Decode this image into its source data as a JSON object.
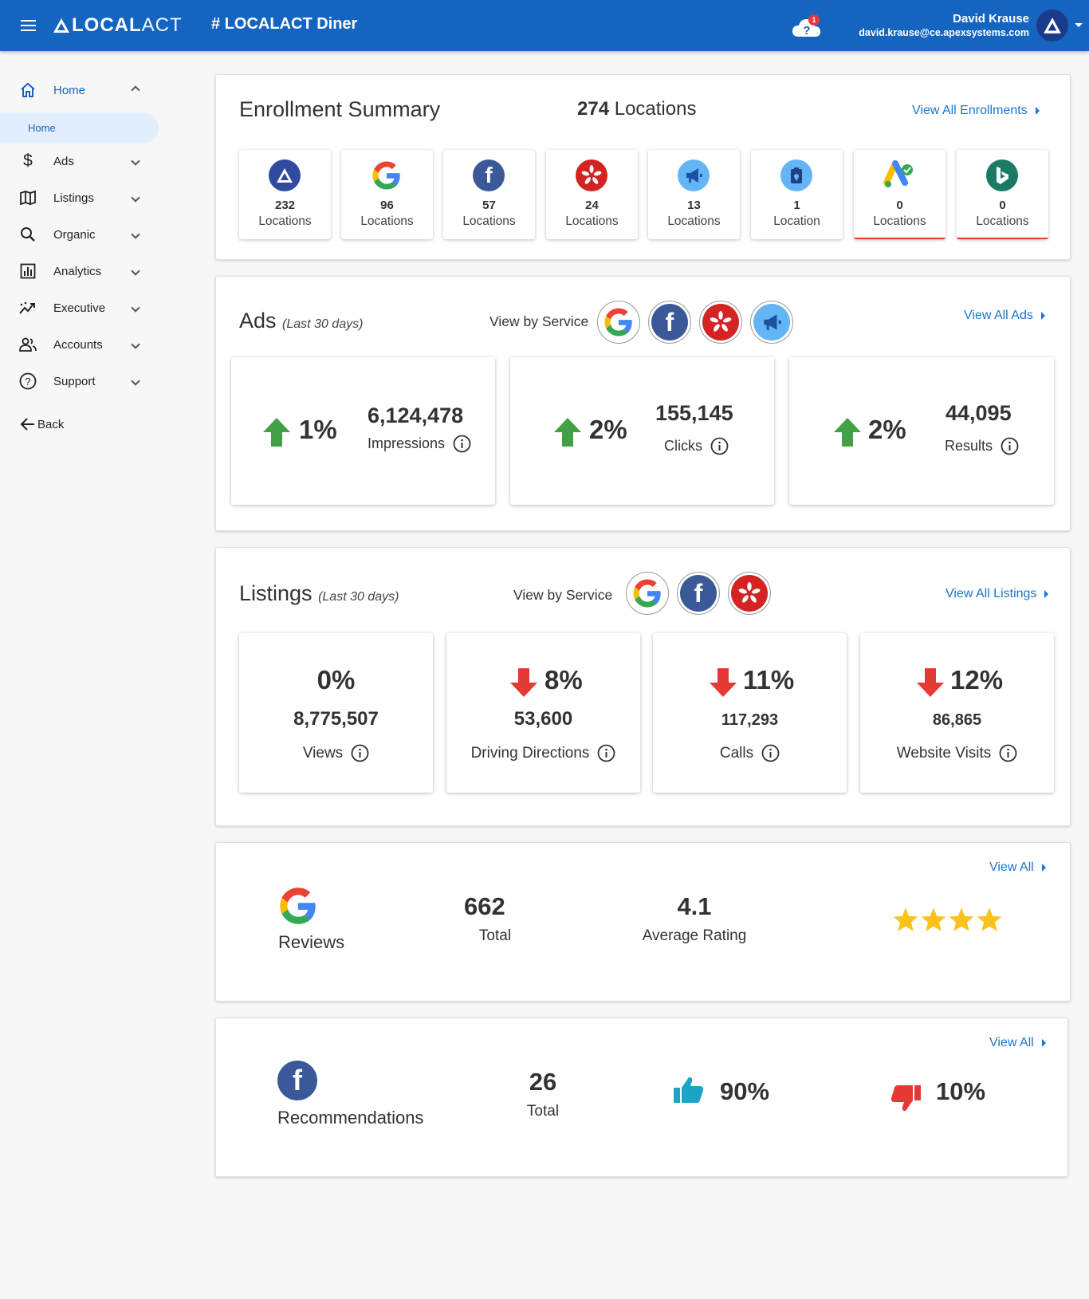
{
  "header": {
    "logo_local": "LOCAL",
    "logo_act": "ACT",
    "site_title": "# LOCALACT Diner",
    "help_badge": "1",
    "user_name": "David Krause",
    "user_email": "david.krause@ce.apexsystems.com",
    "brand_color": "#1565c0"
  },
  "sidebar": {
    "items": [
      {
        "label": "Home",
        "icon": "home-icon"
      },
      {
        "label": "Ads",
        "icon": "dollar-icon"
      },
      {
        "label": "Listings",
        "icon": "map-icon"
      },
      {
        "label": "Organic",
        "icon": "search-icon"
      },
      {
        "label": "Analytics",
        "icon": "analytics-icon"
      },
      {
        "label": "Executive",
        "icon": "trend-icon"
      },
      {
        "label": "Accounts",
        "icon": "people-icon"
      },
      {
        "label": "Support",
        "icon": "help-circle-icon"
      }
    ],
    "home_sub": "Home",
    "back": "Back"
  },
  "enrollment": {
    "title": "Enrollment Summary",
    "total_count": "274",
    "total_label": "Locations",
    "view_all": "View All Enrollments",
    "tiles": [
      {
        "service": "localact",
        "count": "232",
        "label": "Locations"
      },
      {
        "service": "google",
        "count": "96",
        "label": "Locations"
      },
      {
        "service": "facebook",
        "count": "57",
        "label": "Locations"
      },
      {
        "service": "yelp",
        "count": "24",
        "label": "Locations"
      },
      {
        "service": "megaphone",
        "count": "13",
        "label": "Locations"
      },
      {
        "service": "map-pin",
        "count": "1",
        "label": "Location"
      },
      {
        "service": "google-ads",
        "count": "0",
        "label": "Locations"
      },
      {
        "service": "bing",
        "count": "0",
        "label": "Locations"
      }
    ]
  },
  "ads": {
    "title": "Ads",
    "period": "(Last 30 days)",
    "view_by": "View by Service",
    "view_all": "View All Ads",
    "metrics": [
      {
        "change": "1%",
        "direction": "up",
        "value": "6,124,478",
        "label": "Impressions"
      },
      {
        "change": "2%",
        "direction": "up",
        "value": "155,145",
        "label": "Clicks"
      },
      {
        "change": "2%",
        "direction": "up",
        "value": "44,095",
        "label": "Results"
      }
    ]
  },
  "listings": {
    "title": "Listings",
    "period": "(Last 30 days)",
    "view_by": "View by Service",
    "view_all": "View All Listings",
    "metrics": [
      {
        "change": "0%",
        "direction": "none",
        "value": "8,775,507",
        "label": "Views"
      },
      {
        "change": "8%",
        "direction": "down",
        "value": "53,600",
        "label": "Driving Directions"
      },
      {
        "change": "11%",
        "direction": "down",
        "value": "117,293",
        "label": "Calls"
      },
      {
        "change": "12%",
        "direction": "down",
        "value": "86,865",
        "label": "Website Visits"
      }
    ]
  },
  "reviews": {
    "label": "Reviews",
    "total": "662",
    "total_label": "Total",
    "rating": "4.1",
    "rating_label": "Average Rating",
    "stars": 4,
    "view_all": "View All"
  },
  "recommendations": {
    "label": "Recommendations",
    "total": "26",
    "total_label": "Total",
    "positive": "90%",
    "negative": "10%",
    "view_all": "View All"
  },
  "colors": {
    "up": "#43a047",
    "down": "#e53935",
    "link": "#1976d2",
    "star": "#f9c31b",
    "thumb_up": "#1aa5c8",
    "thumb_down": "#e53935"
  }
}
